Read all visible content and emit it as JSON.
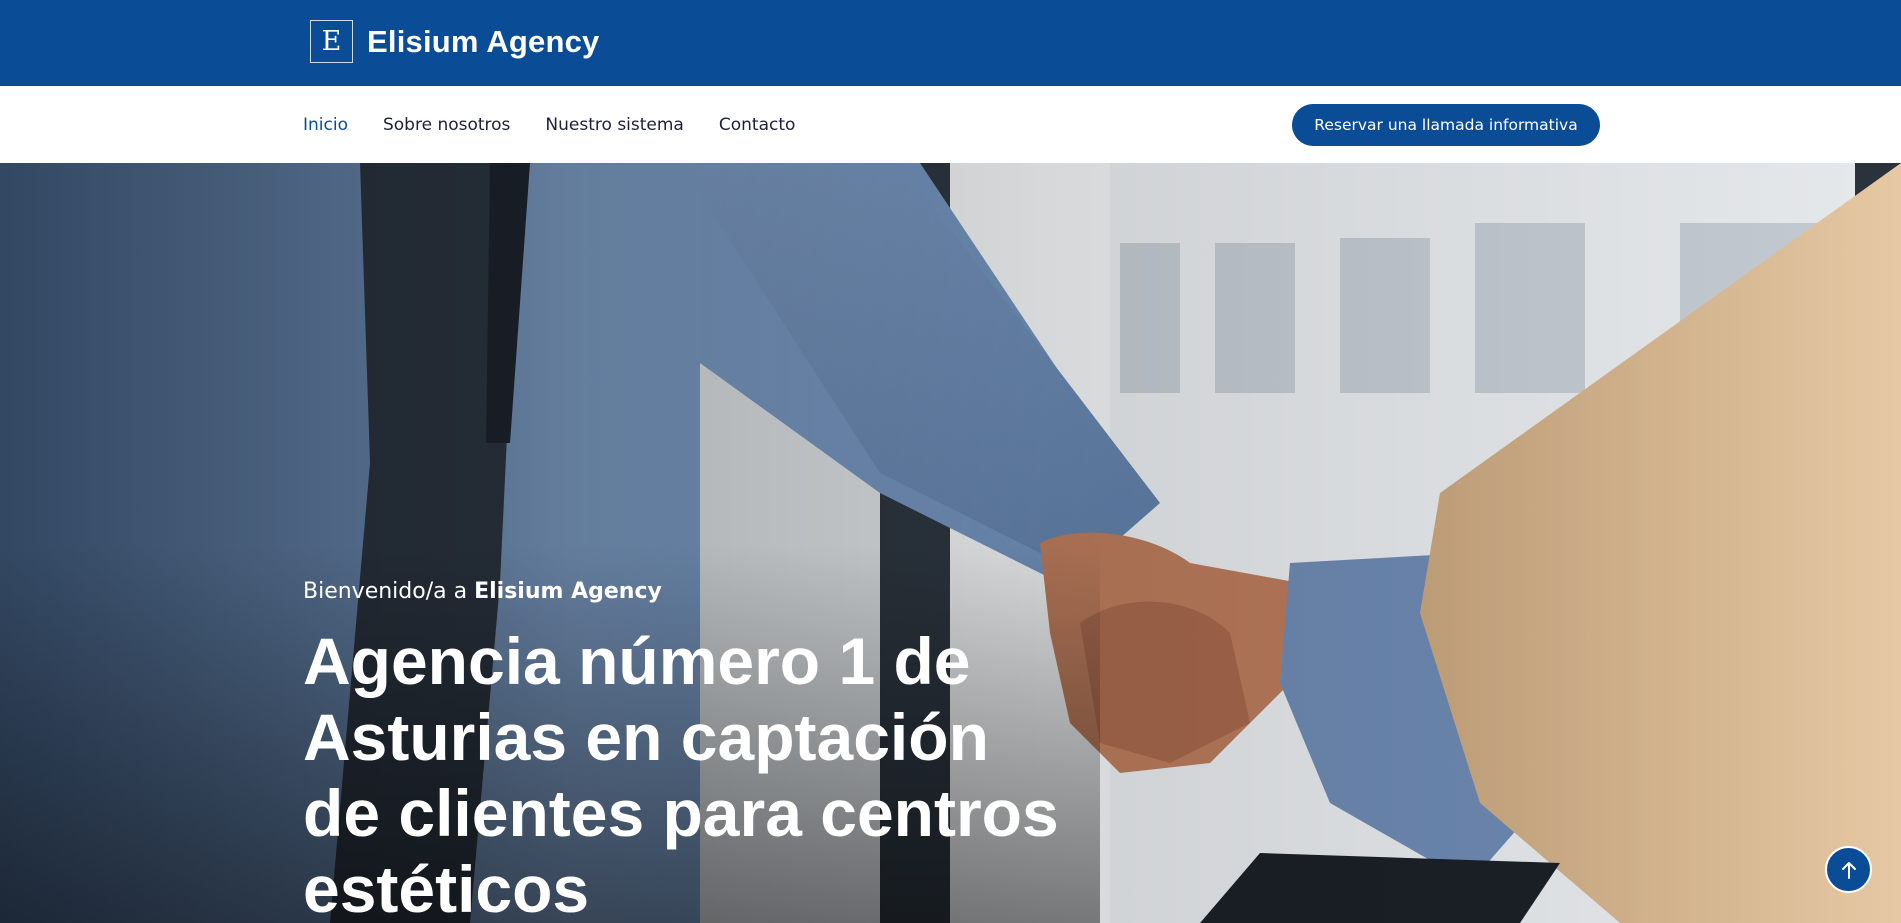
{
  "brand": {
    "logo_letter": "E",
    "name": "Elisium Agency"
  },
  "nav": {
    "items": [
      {
        "label": "Inicio",
        "active": true
      },
      {
        "label": "Sobre nosotros",
        "active": false
      },
      {
        "label": "Nuestro sistema",
        "active": false
      },
      {
        "label": "Contacto",
        "active": false
      }
    ],
    "cta_label": "Reservar una llamada informativa"
  },
  "hero": {
    "welcome_prefix": "Bienvenido/a a ",
    "welcome_brand": "Elisium Agency",
    "title": "Agencia número 1 de Asturias en captación de clientes para centros estéticos",
    "image": "handshake-photo"
  },
  "icons": {
    "scroll_top": "arrow-up-icon"
  },
  "colors": {
    "primary": "#0b4c97",
    "text_dark": "#1b2238",
    "white": "#ffffff"
  }
}
